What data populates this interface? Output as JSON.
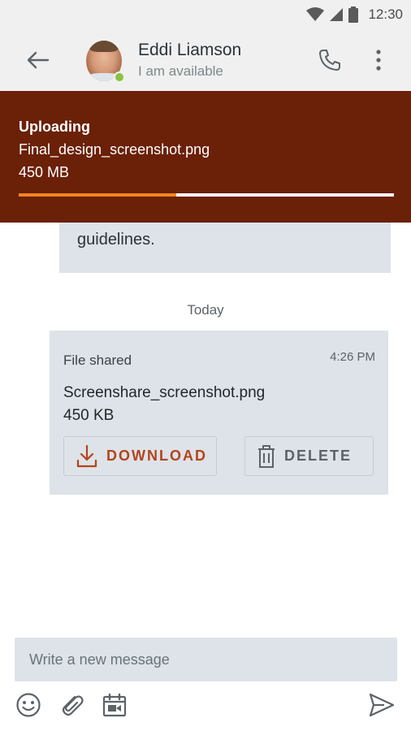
{
  "status_bar": {
    "time": "12:30",
    "icons": [
      "wifi-icon",
      "signal-icon",
      "battery-icon"
    ]
  },
  "header": {
    "back_icon": "arrow-left-icon",
    "contact_name": "Eddi Liamson",
    "contact_status": "I am available",
    "presence_color": "#8ac13f",
    "call_icon": "phone-icon",
    "more_icon": "more-vertical-icon"
  },
  "upload": {
    "title": "Uploading",
    "file_name": "Final_design_screenshot.png",
    "file_size": "450 MB",
    "progress": 0.42,
    "background": "#6b2008",
    "progress_color": "#f0871d"
  },
  "chat": {
    "previous_message_text": "guidelines.",
    "date_separator": "Today",
    "file_message": {
      "label": "File shared",
      "time": "4:26 PM",
      "file_name": "Screenshare_screenshot.png",
      "file_size": "450 KB",
      "download_label": "DOWNLOAD",
      "delete_label": "DELETE",
      "accent": "#b5431b"
    }
  },
  "composer": {
    "placeholder": "Write a new message",
    "value": "",
    "toolbar_icons": [
      "emoji-icon",
      "paperclip-icon",
      "calendar-video-icon",
      "send-icon"
    ]
  }
}
